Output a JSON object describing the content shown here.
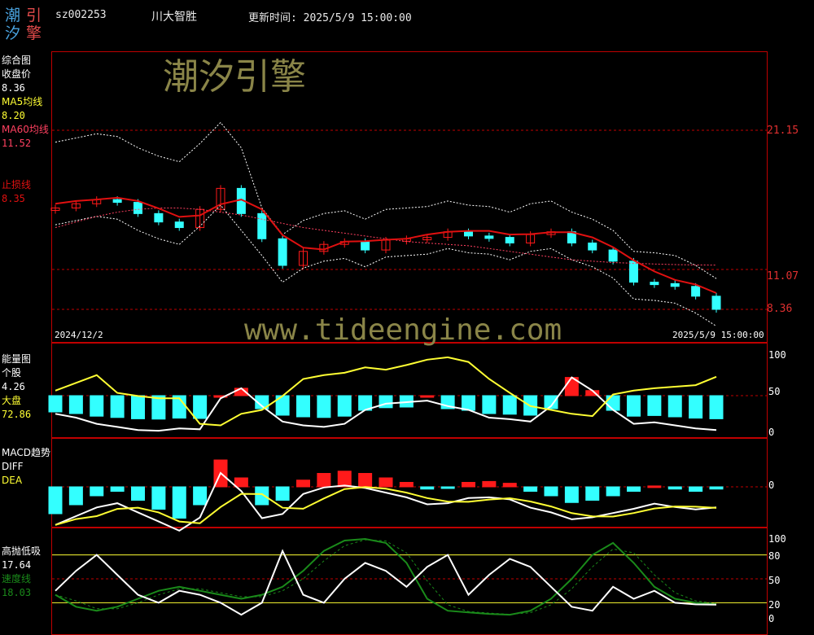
{
  "colors": {
    "background": "#000000",
    "frame": "#c00000",
    "up": "#ff1a1a",
    "down": "#33ffff",
    "ma5": "#ffff33",
    "ma60": "#ff4060",
    "stop": "#e01010",
    "green": "#1a8a1a"
  },
  "header": {
    "logo_chars": [
      "潮",
      "引",
      "汐",
      "擎"
    ],
    "code": "sz002253",
    "name": "川大智胜",
    "updated": "更新时间: 2025/5/9 15:00:00"
  },
  "watermark": {
    "title": "潮汐引擎",
    "url": "www.tideengine.com"
  },
  "main_panel": {
    "title": "综合图",
    "close_label": "收盘价",
    "close_value": "8.36",
    "ma5_label": "MA5均线",
    "ma5_value": "8.20",
    "ma60_label": "MA60均线",
    "ma60_value": "11.52",
    "stop_label": "止损线",
    "stop_value": "8.35",
    "price_ticks": [
      "21.15",
      "11.07",
      "8.36"
    ],
    "date_start": "2024/12/2",
    "date_end": "2025/5/9 15:00:00"
  },
  "energy_panel": {
    "title": "能量图",
    "stock_label": "个股",
    "stock_value": "4.26",
    "market_label": "大盘",
    "market_value": "72.86",
    "ticks": [
      "100",
      "50",
      "0"
    ]
  },
  "macd_panel": {
    "title": "MACD趋势",
    "diff_label": "DIFF",
    "dea_label": "DEA",
    "ticks": [
      "0"
    ]
  },
  "osc_panel": {
    "title": "高抛低吸",
    "title_value": "17.64",
    "speed_label": "速度线",
    "speed_value": "18.03",
    "ticks": [
      "100",
      "80",
      "50",
      "20",
      "0"
    ]
  },
  "chart_data": [
    {
      "type": "line",
      "title": "综合图",
      "x_start": "2024/12/2",
      "x_end": "2025/5/9",
      "series": [
        {
          "name": "收盘价",
          "values": [
            15.6,
            15.9,
            16.2,
            16.0,
            15.2,
            14.6,
            14.2,
            15.5,
            17.0,
            15.2,
            13.4,
            11.5,
            12.5,
            13.0,
            13.2,
            12.6,
            13.3,
            13.4,
            13.5,
            13.9,
            13.6,
            13.5,
            13.1,
            13.7,
            13.9,
            13.1,
            12.6,
            11.8,
            10.3,
            10.2,
            10.0,
            9.3,
            8.36
          ]
        },
        {
          "name": "MA60均线",
          "values": [
            14.2,
            14.6,
            15.0,
            15.3,
            15.5,
            15.6,
            15.6,
            15.5,
            15.3,
            15.1,
            14.8,
            14.5,
            14.2,
            14.0,
            13.8,
            13.6,
            13.4,
            13.2,
            13.1,
            13.0,
            12.9,
            12.7,
            12.5,
            12.3,
            12.1,
            11.9,
            11.8,
            11.7,
            11.65,
            11.6,
            11.56,
            11.53,
            11.52
          ]
        }
      ]
    },
    {
      "type": "line",
      "title": "能量图",
      "series": [
        {
          "name": "个股",
          "values": [
            25,
            20,
            12,
            8,
            4,
            3,
            6,
            5,
            45,
            58,
            35,
            15,
            10,
            8,
            12,
            30,
            38,
            40,
            42,
            35,
            30,
            20,
            18,
            15,
            35,
            72,
            55,
            30,
            12,
            14,
            10,
            6,
            4
          ]
        },
        {
          "name": "大盘",
          "values": [
            55,
            65,
            75,
            52,
            48,
            45,
            45,
            12,
            10,
            25,
            30,
            48,
            70,
            75,
            78,
            85,
            82,
            88,
            95,
            98,
            92,
            70,
            52,
            35,
            30,
            25,
            22,
            50,
            55,
            58,
            60,
            62,
            72.86
          ]
        }
      ]
    },
    {
      "type": "bar",
      "title": "MACD趋势",
      "values": [
        -0.6,
        -0.4,
        -0.2,
        -0.1,
        -0.3,
        -0.5,
        -0.7,
        -0.4,
        0.6,
        0.2,
        -0.4,
        -0.3,
        0.15,
        0.3,
        0.35,
        0.3,
        0.2,
        0.1,
        -0.05,
        -0.02,
        0.1,
        0.12,
        0.08,
        -0.1,
        -0.2,
        -0.35,
        -0.3,
        -0.2,
        -0.1,
        0.02,
        -0.05,
        -0.1,
        -0.05
      ]
    },
    {
      "type": "line",
      "title": "高抛低吸",
      "series": [
        {
          "name": "高抛低吸",
          "values": [
            35,
            60,
            80,
            55,
            30,
            20,
            35,
            30,
            20,
            5,
            20,
            85,
            30,
            20,
            50,
            70,
            60,
            40,
            65,
            80,
            30,
            55,
            75,
            65,
            40,
            15,
            10,
            40,
            25,
            35,
            20,
            18,
            17.64
          ]
        },
        {
          "name": "速度线",
          "values": [
            30,
            15,
            10,
            15,
            25,
            35,
            40,
            35,
            30,
            25,
            30,
            40,
            60,
            85,
            98,
            100,
            95,
            70,
            25,
            10,
            8,
            6,
            5,
            10,
            25,
            50,
            80,
            95,
            70,
            40,
            25,
            20,
            18.03
          ]
        }
      ]
    }
  ]
}
